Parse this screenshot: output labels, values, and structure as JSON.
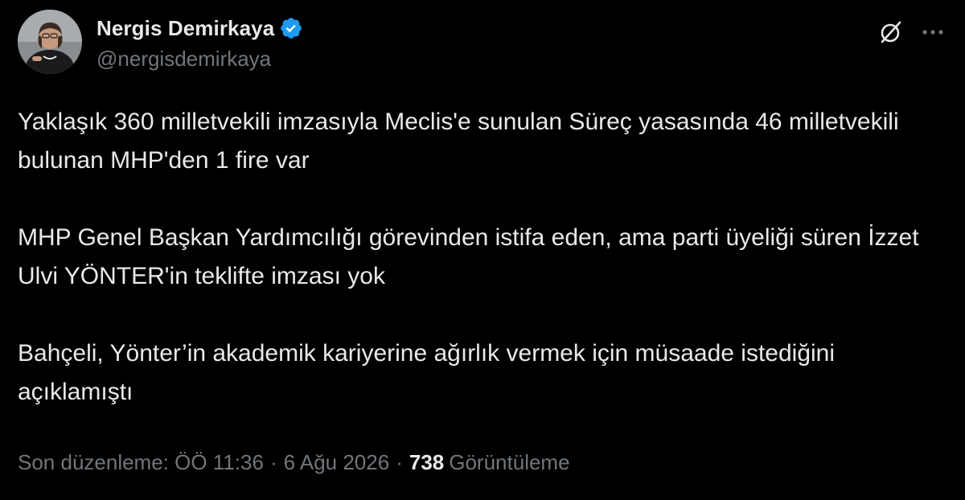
{
  "author": {
    "display_name": "Nergis Demirkaya",
    "handle": "@nergisdemirkaya",
    "verified": true,
    "avatar_icon": "profile-photo"
  },
  "header_actions": {
    "grok_icon": "grok-icon",
    "more_icon": "more-dots-icon"
  },
  "tweet": {
    "paragraphs": [
      "Yaklaşık 360 milletvekili imzasıyla Meclis'e sunulan Süreç yasasında 46 milletvekili bulunan MHP'den 1 fire var",
      "MHP Genel Başkan Yardımcılığı görevinden istifa eden, ama parti üyeliği süren İzzet Ulvi YÖNTER'in teklifte imzası yok",
      "Bahçeli, Yönter’in akademik kariyerine ağırlık vermek için müsaade istediğini açıklamıştı"
    ]
  },
  "meta": {
    "edited_label": "Son düzenleme: ÖÖ 11:36",
    "separator": "·",
    "date": "6 Ağu 2026",
    "views_count": "738",
    "views_label": "Görüntüleme"
  },
  "colors": {
    "background": "#000000",
    "text_primary": "#e7e9ea",
    "text_secondary": "#71767b",
    "verified_blue": "#1d9bf0"
  }
}
